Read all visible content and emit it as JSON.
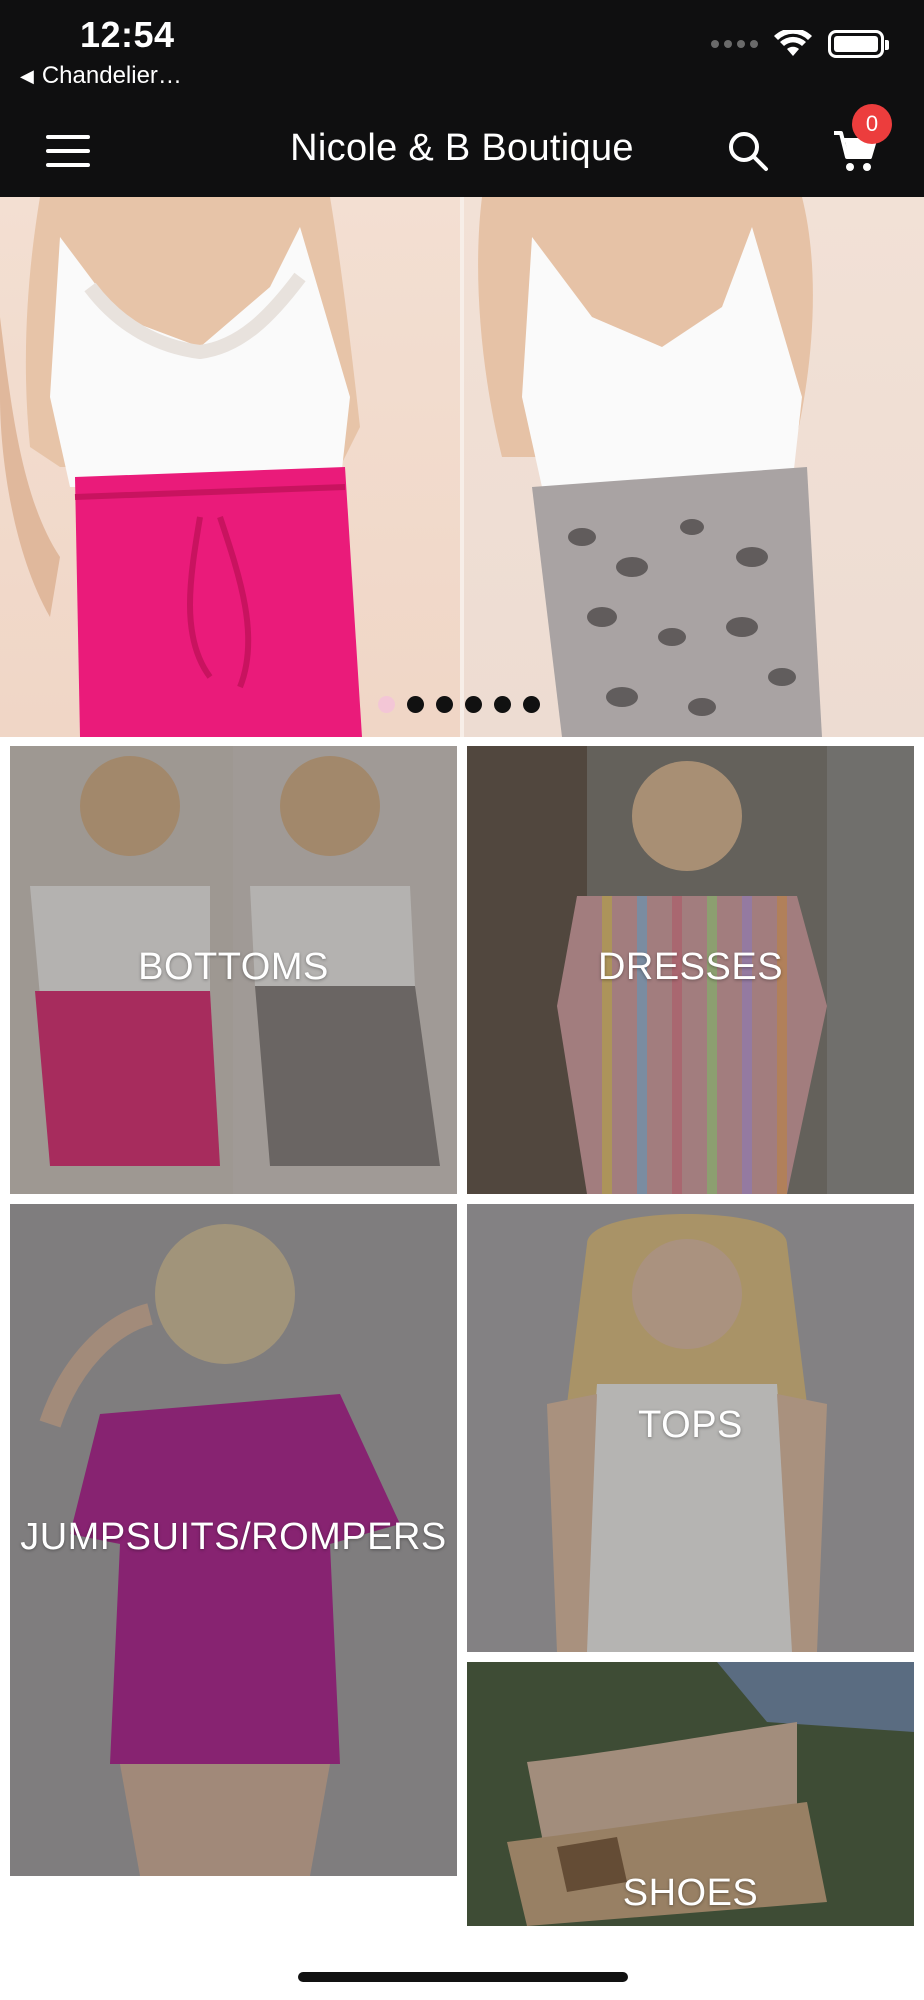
{
  "status_bar": {
    "time": "12:54",
    "back_app": "Chandelier…"
  },
  "header": {
    "title": "Nicole & B Boutique",
    "menu_icon": "hamburger-menu-icon",
    "search_icon": "search-icon",
    "cart_icon": "shopping-cart-icon",
    "cart_count": "0"
  },
  "hero": {
    "slide_count": 6,
    "active_slide": 1
  },
  "categories": [
    {
      "label": "BOTTOMS"
    },
    {
      "label": "DRESSES"
    },
    {
      "label": "JUMPSUITS/ROMPERS"
    },
    {
      "label": "TOPS"
    },
    {
      "label": "SHOES"
    }
  ],
  "colors": {
    "header_bg": "#0f0f10",
    "badge": "#ec3d3d",
    "active_dot": "#f3c6d6"
  }
}
